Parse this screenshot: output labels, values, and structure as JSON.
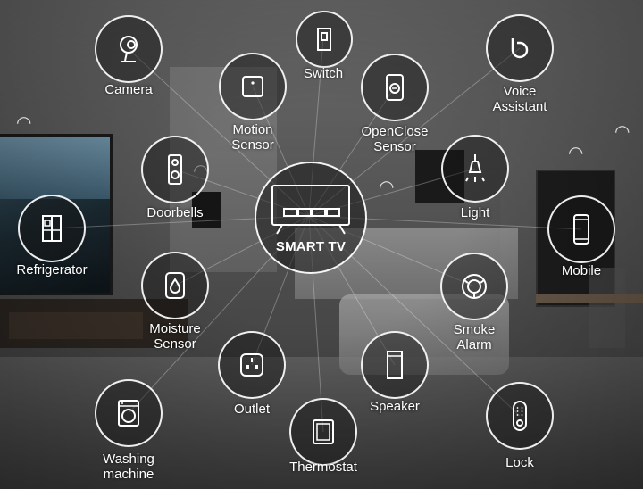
{
  "hub": {
    "label": "SMART TV",
    "icon": "smart-tv-icon"
  },
  "devices": [
    {
      "id": "camera",
      "label": "Camera",
      "icon": "camera-icon"
    },
    {
      "id": "switch",
      "label": "Switch",
      "icon": "switch-icon"
    },
    {
      "id": "voice-assistant",
      "label": "Voice\nAssistant",
      "icon": "voice-assistant-icon"
    },
    {
      "id": "motion-sensor",
      "label": "Motion\nSensor",
      "icon": "motion-sensor-icon"
    },
    {
      "id": "openclose-sensor",
      "label": "OpenClose\nSensor",
      "icon": "openclose-sensor-icon"
    },
    {
      "id": "doorbells",
      "label": "Doorbells",
      "icon": "doorbell-icon"
    },
    {
      "id": "light",
      "label": "Light",
      "icon": "light-icon"
    },
    {
      "id": "refrigerator",
      "label": "Refrigerator",
      "icon": "refrigerator-icon"
    },
    {
      "id": "mobile",
      "label": "Mobile",
      "icon": "mobile-icon"
    },
    {
      "id": "moisture-sensor",
      "label": "Moisture\nSensor",
      "icon": "moisture-sensor-icon"
    },
    {
      "id": "smoke-alarm",
      "label": "Smoke\nAlarm",
      "icon": "smoke-alarm-icon"
    },
    {
      "id": "outlet",
      "label": "Outlet",
      "icon": "outlet-icon"
    },
    {
      "id": "speaker",
      "label": "Speaker",
      "icon": "speaker-icon"
    },
    {
      "id": "washing-machine",
      "label": "Washing\nmachine",
      "icon": "washing-machine-icon"
    },
    {
      "id": "thermostat",
      "label": "Thermostat",
      "icon": "thermostat-icon"
    },
    {
      "id": "lock",
      "label": "Lock",
      "icon": "lock-icon"
    }
  ],
  "colors": {
    "ring": "#ffffff",
    "text": "#ffffff"
  }
}
